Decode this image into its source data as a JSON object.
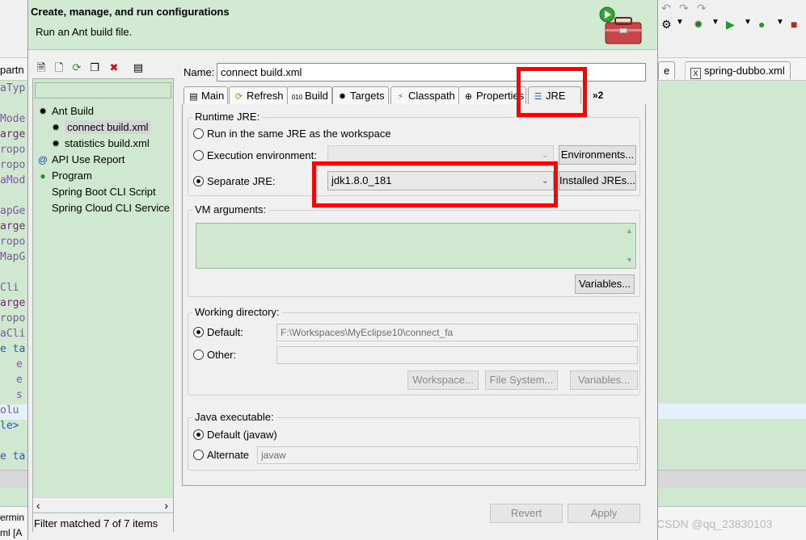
{
  "background": {
    "left_tab_fragment": "partn",
    "left_code_fragments": [
      "aTyp",
      "Mode",
      "arge",
      "ropo",
      "ropo",
      "aMod",
      "apGe",
      "arge",
      "ropo",
      "MapG",
      "Cli",
      "arge",
      "ropo",
      "aCli",
      "e ta",
      "e",
      "e",
      "s",
      "olu",
      "le>",
      "e ta"
    ],
    "left_bottom_fragment": "ermin",
    "left_bottom_fragment2": "ml [A",
    "right_tab_fragment": "e",
    "right_tab_label": "spring-dubbo.xml",
    "xml_badge": "X"
  },
  "watermark": "CSDN @qq_23830103",
  "dialog": {
    "title": "Create, manage, and run configurations",
    "subtitle": "Run an Ant build file.",
    "tree": {
      "items": [
        {
          "label": "Ant Build",
          "icon": "ant-icon"
        },
        {
          "label": "connect build.xml",
          "icon": "ant-icon"
        },
        {
          "label": "statistics build.xml",
          "icon": "ant-icon"
        },
        {
          "label": "API Use Report",
          "icon": "api-icon"
        },
        {
          "label": "Program",
          "icon": "program-icon"
        },
        {
          "label": "Spring Boot CLI Script",
          "icon": ""
        },
        {
          "label": "Spring Cloud CLI Service",
          "icon": ""
        }
      ],
      "filter_status": "Filter matched 7 of 7 items"
    },
    "name_label": "Name:",
    "name_value": "connect build.xml",
    "tabs": [
      {
        "label": "Main"
      },
      {
        "label": "Refresh"
      },
      {
        "label": "Build"
      },
      {
        "label": "Targets"
      },
      {
        "label": "Classpath"
      },
      {
        "label": "Properties"
      },
      {
        "label": "JRE"
      }
    ],
    "tabs_more": "»2",
    "runtime_jre": {
      "title": "Runtime JRE:",
      "same_jre": "Run in the same JRE as the workspace",
      "exec_env": "Execution environment:",
      "environments_btn": "Environments...",
      "separate_jre": "Separate JRE:",
      "separate_jre_value": "jdk1.8.0_181",
      "installed_jres_btn": "Installed JREs..."
    },
    "vm_arguments": {
      "title": "VM arguments:",
      "variables_btn": "Variables..."
    },
    "working_directory": {
      "title": "Working directory:",
      "default_label": "Default:",
      "default_value": "F:\\Workspaces\\MyEclipse10\\connect_fa",
      "other_label": "Other:",
      "workspace_btn": "Workspace...",
      "filesystem_btn": "File System...",
      "variables_btn": "Variables..."
    },
    "java_executable": {
      "title": "Java executable:",
      "default_label": "Default (javaw)",
      "alternate_label": "Alternate",
      "alternate_value": "javaw"
    },
    "revert_btn": "Revert",
    "apply_btn": "Apply"
  },
  "colors": {
    "dialog_bg": "#f0f0f0",
    "header_bg": "#d2ead2",
    "field_green": "#cfe8cf",
    "annotation_red": "#ff0000"
  }
}
